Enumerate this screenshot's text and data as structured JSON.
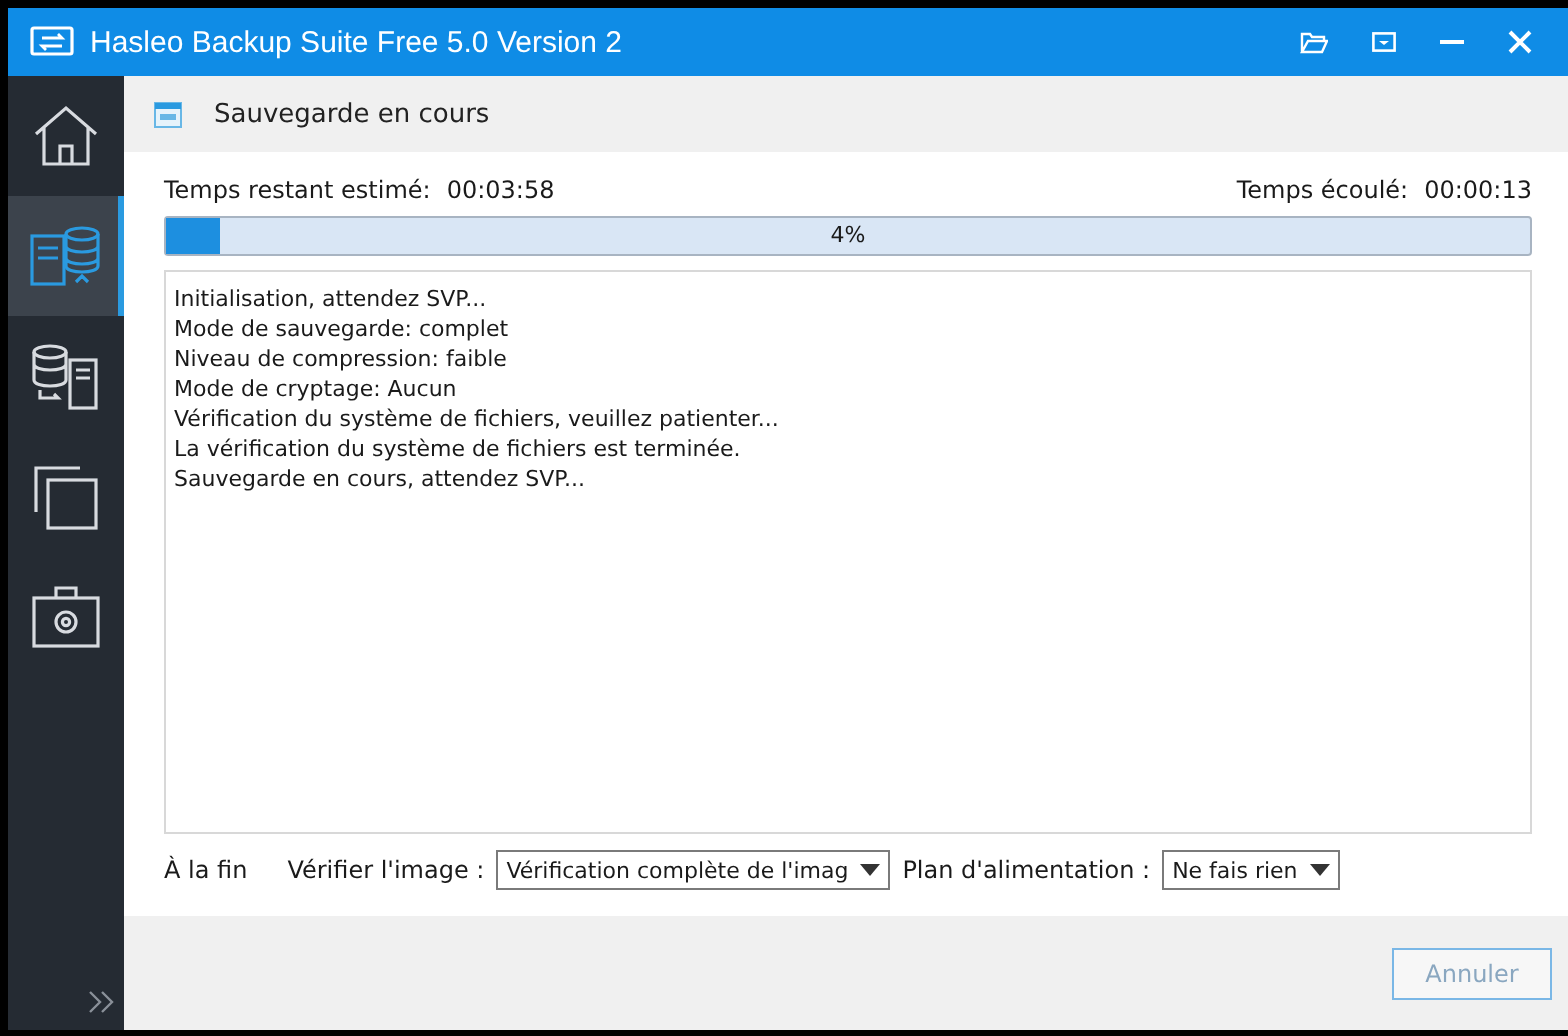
{
  "window": {
    "title": "Hasleo Backup Suite Free 5.0 Version 2"
  },
  "sidebar": {
    "items": [
      {
        "kind": "home",
        "selected": false
      },
      {
        "kind": "backup",
        "selected": true
      },
      {
        "kind": "restore",
        "selected": false
      },
      {
        "kind": "clone",
        "selected": false
      },
      {
        "kind": "tools",
        "selected": false
      }
    ]
  },
  "page": {
    "title": "Sauvegarde en cours"
  },
  "progress": {
    "remaining_label": "Temps restant estimé:",
    "remaining": "00:03:58",
    "elapsed_label": "Temps écoulé:",
    "elapsed": "00:00:13",
    "level": 0.04,
    "reading": "4%"
  },
  "log": [
    "Initialisation, attendez SVP...",
    "Mode de sauvegarde: complet",
    "Niveau de compression: faible",
    "Mode de cryptage: Aucun",
    "Vérification du système de fichiers, veuillez patienter...",
    "La vérification du système de fichiers est terminée.",
    "Sauvegarde en cours, attendez SVP..."
  ],
  "options": {
    "label": "À la fin",
    "verify_label": "Vérifier l'image :",
    "verify_value": "Vérification complète de l'imag",
    "power_label": "Plan d'alimentation :",
    "power_value": "Ne fais rien"
  },
  "buttons": [
    {
      "label": "Annuler",
      "disabled": true
    }
  ]
}
